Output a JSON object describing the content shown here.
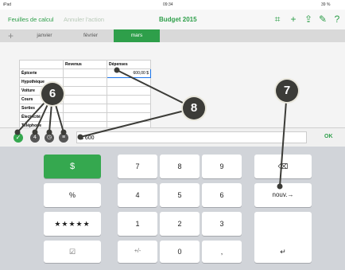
{
  "status_bar": {
    "carrier": "iPad",
    "time": "09:34",
    "battery": "39 %"
  },
  "toolbar": {
    "back_label": "Feuilles de calcul",
    "undo_label": "Annuler l'action",
    "title": "Budget 2015"
  },
  "tabs": {
    "add": "+",
    "items": [
      "janvier",
      "février",
      "mars"
    ],
    "active": "mars"
  },
  "sheet": {
    "headers": [
      "Revenus",
      "Dépenses"
    ],
    "rows": [
      {
        "label": "Épicerie",
        "revenus": "",
        "depenses": "600,00 $"
      },
      {
        "label": "Hypothèque",
        "revenus": "",
        "depenses": ""
      },
      {
        "label": "Voiture",
        "revenus": "",
        "depenses": ""
      },
      {
        "label": "Cours",
        "revenus": "",
        "depenses": ""
      },
      {
        "label": "Sorties",
        "revenus": "",
        "depenses": ""
      },
      {
        "label": "Électricité",
        "revenus": "",
        "depenses": ""
      },
      {
        "label": "Téléphone",
        "revenus": "",
        "depenses": ""
      }
    ]
  },
  "callouts": {
    "c6": "6",
    "c8": "8",
    "c7": "7"
  },
  "formula_bar": {
    "value": "$ 600",
    "ok_label": "OK"
  },
  "keyboard": {
    "currency": "$",
    "percent": "%",
    "stars": "★★★★★",
    "checkbox": "☑",
    "digits": [
      "7",
      "8",
      "9",
      "4",
      "5",
      "6",
      "1",
      "2",
      "3",
      "0"
    ],
    "plus_minus": "+/-",
    "decimal": ",",
    "delete": "⌫",
    "next_line": "nouv.→",
    "enter": "↵"
  }
}
